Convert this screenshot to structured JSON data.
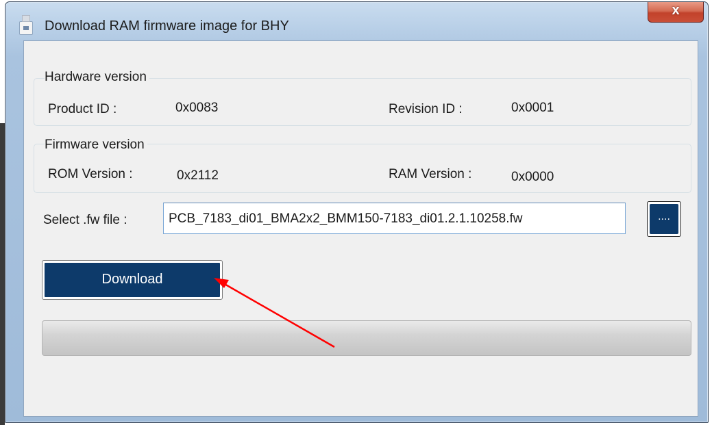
{
  "window": {
    "title": "Download RAM firmware image for BHY",
    "close_glyph": "x"
  },
  "hardware": {
    "group_title": "Hardware version",
    "product_id_label": "Product ID :",
    "product_id_value": "0x0083",
    "revision_id_label": "Revision ID :",
    "revision_id_value": "0x0001"
  },
  "firmware": {
    "group_title": "Firmware version",
    "rom_label": "ROM Version :",
    "rom_value": "0x2112",
    "ram_label": "RAM Version :",
    "ram_value": "0x0000"
  },
  "file": {
    "label": "Select .fw file :",
    "value": "PCB_7183_di01_BMA2x2_BMM150-7183_di01.2.1.10258.fw",
    "browse_label": "...."
  },
  "actions": {
    "download_label": "Download"
  },
  "progress": {
    "value": 0
  },
  "annotation": {
    "arrow_color": "#ff0000"
  },
  "colors": {
    "button_fill": "#0d3a6a",
    "client_bg": "#f0f0f0",
    "close_red": "#c94e37"
  }
}
